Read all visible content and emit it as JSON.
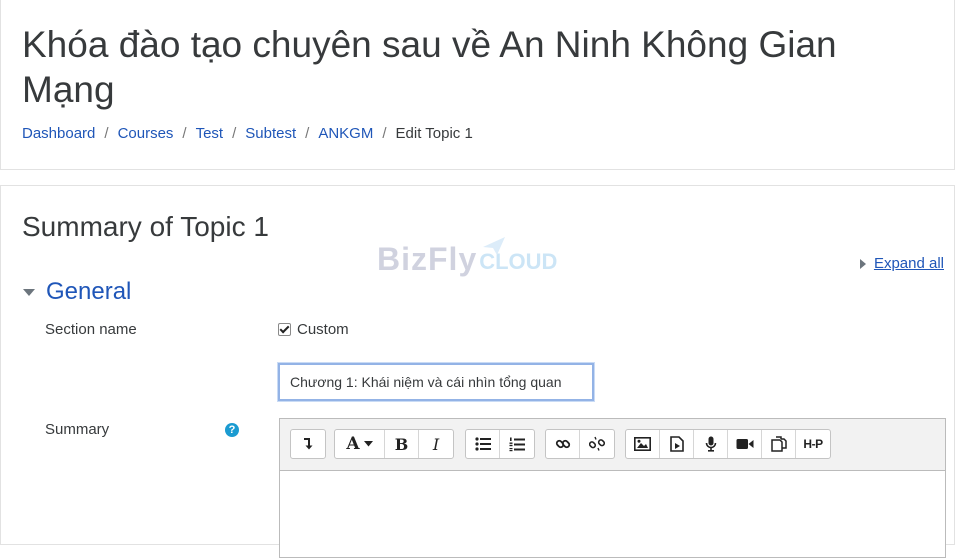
{
  "course": {
    "title": "Khóa đào tạo chuyên sau về An Ninh Không Gian Mạng"
  },
  "breadcrumb": {
    "items": [
      "Dashboard",
      "Courses",
      "Test",
      "Subtest",
      "ANKGM"
    ],
    "current": "Edit Topic 1",
    "separator": "/"
  },
  "form": {
    "title": "Summary of Topic 1",
    "expand_all": "Expand all",
    "section": {
      "title": "General"
    },
    "section_name": {
      "label": "Section name",
      "custom_label": "Custom",
      "custom_checked": true,
      "value": "Chương 1: Khái niệm và cái nhìn tổng quan"
    },
    "summary": {
      "label": "Summary",
      "help_icon": "?"
    }
  },
  "watermark": {
    "brand": "BizFly",
    "suffix": "CLOUD"
  },
  "editor": {
    "toolbar": [
      [
        "show-more-icon"
      ],
      [
        "font-style-icon",
        "bold-icon",
        "italic-icon"
      ],
      [
        "unordered-list-icon",
        "ordered-list-icon"
      ],
      [
        "link-icon",
        "unlink-icon"
      ],
      [
        "image-icon",
        "media-icon",
        "record-audio-icon",
        "record-video-icon",
        "manage-files-icon",
        "h5p-icon"
      ]
    ],
    "font_glyph": "A",
    "bold_glyph": "B",
    "italic_glyph": "I",
    "h5p_glyph": "H-P"
  },
  "colors": {
    "link": "#1f56b8",
    "help": "#1b9bd1",
    "focus_border": "#93b3e6"
  }
}
